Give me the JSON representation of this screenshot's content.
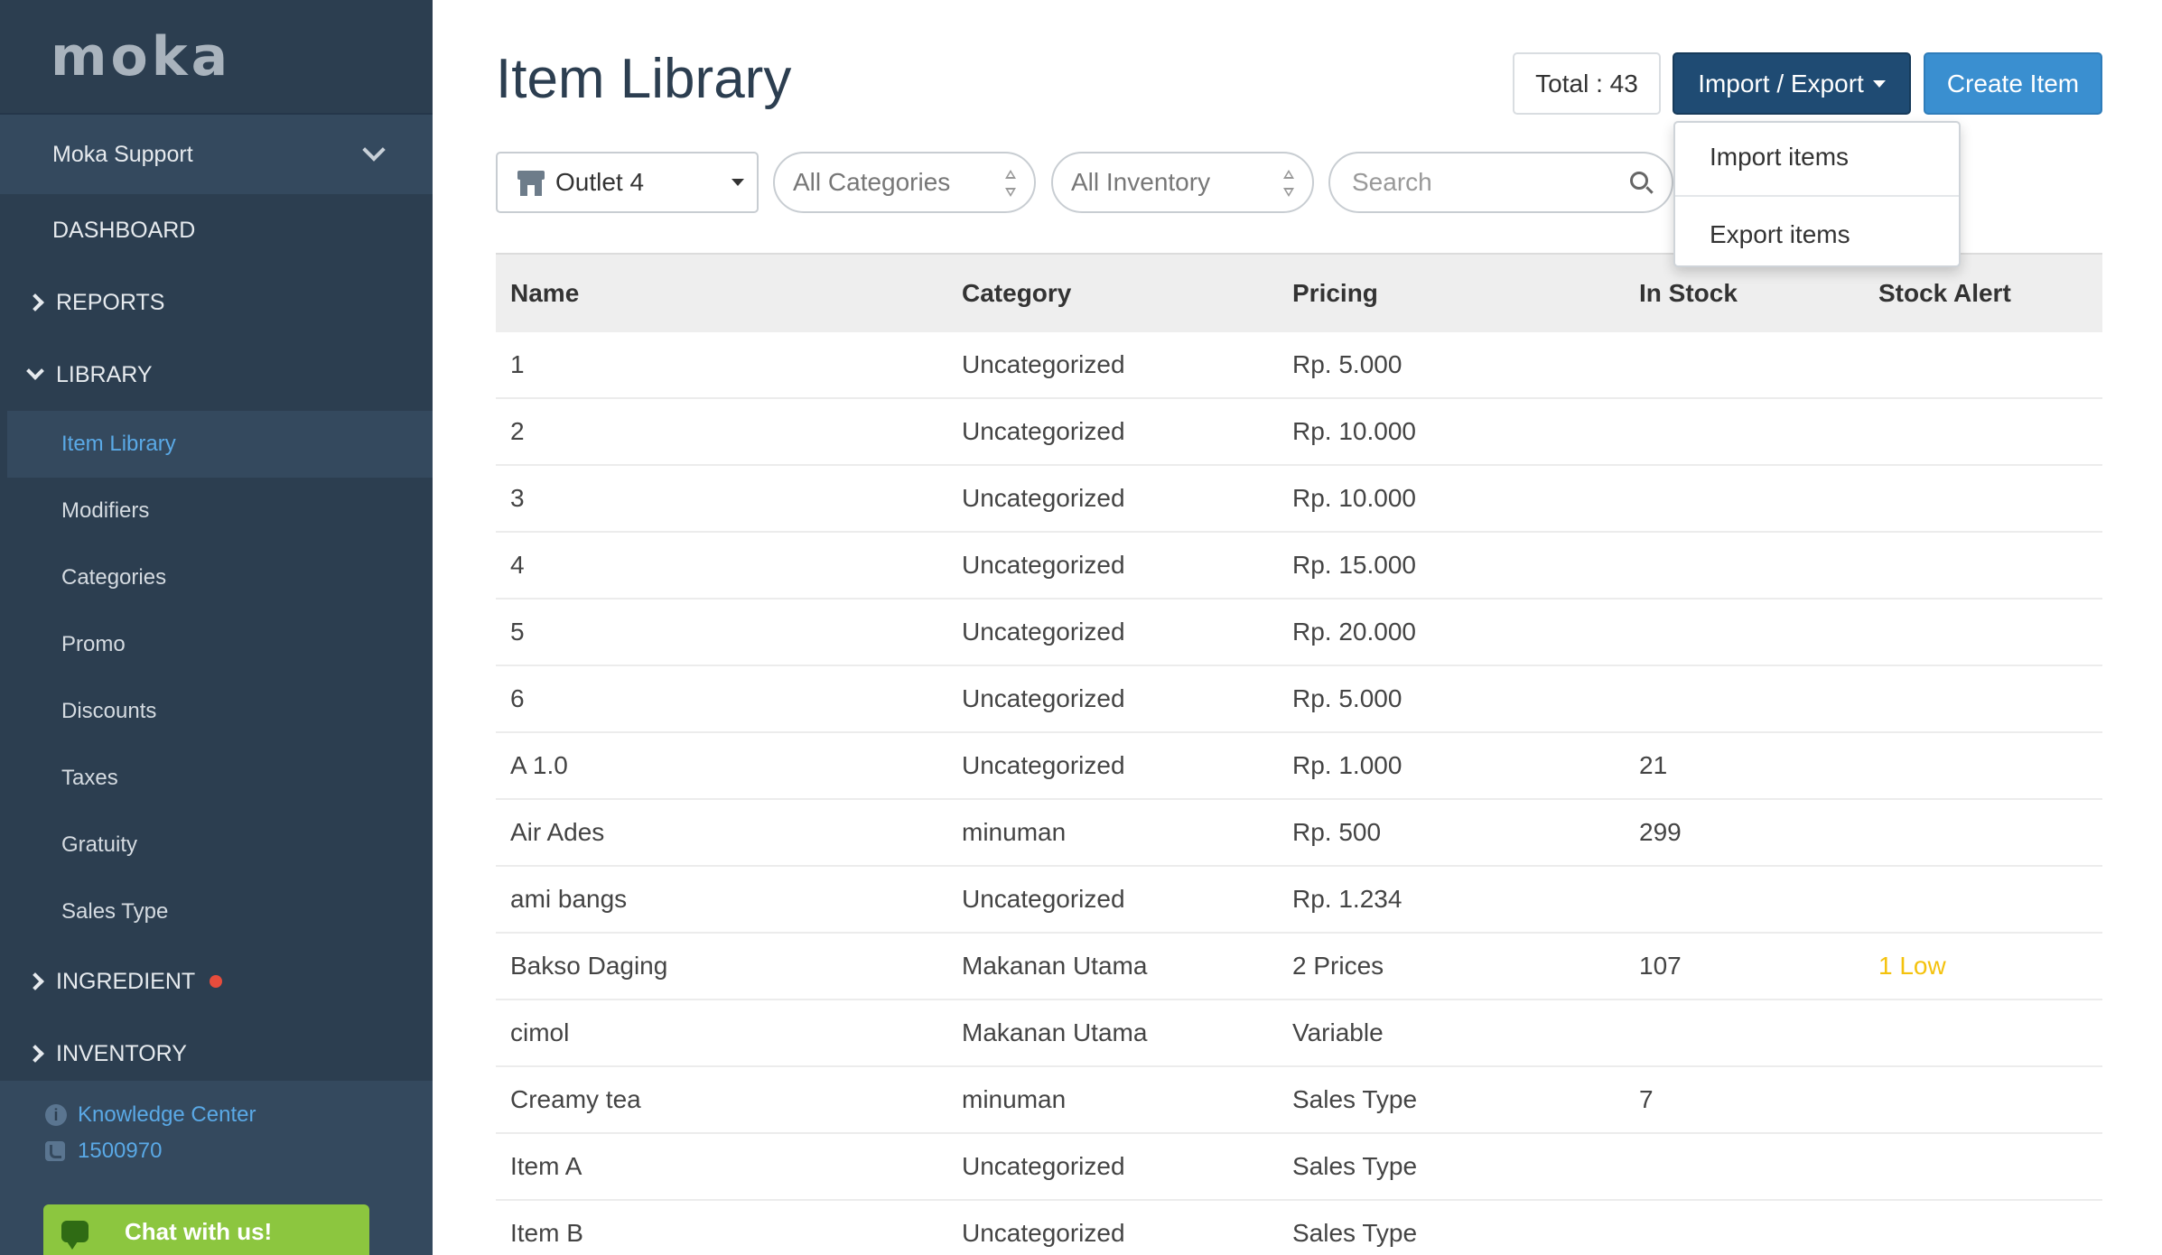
{
  "sidebar": {
    "logo": "moka",
    "account": "Moka Support",
    "dashboard": "DASHBOARD",
    "reports": "REPORTS",
    "library": "LIBRARY",
    "library_items": [
      "Item Library",
      "Modifiers",
      "Categories",
      "Promo",
      "Discounts",
      "Taxes",
      "Gratuity",
      "Sales Type"
    ],
    "ingredient": "INGREDIENT",
    "inventory": "INVENTORY",
    "knowledge_center": "Knowledge Center",
    "phone": "1500970",
    "chat": "Chat with us!",
    "active_color": "#5aa9e6",
    "alert_color": "#e74c3c"
  },
  "header": {
    "title": "Item Library",
    "total": "Total : 43",
    "import_export": "Import / Export",
    "create_item": "Create Item"
  },
  "dropdown": {
    "import": "Import items",
    "export": "Export items"
  },
  "filters": {
    "outlet": "Outlet 4",
    "categories": "All Categories",
    "inventory": "All Inventory",
    "search_placeholder": "Search"
  },
  "table": {
    "headers": [
      "Name",
      "Category",
      "Pricing",
      "In Stock",
      "Stock Alert"
    ],
    "rows": [
      [
        "1",
        "Uncategorized",
        "Rp. 5.000",
        "",
        ""
      ],
      [
        "2",
        "Uncategorized",
        "Rp. 10.000",
        "",
        ""
      ],
      [
        "3",
        "Uncategorized",
        "Rp. 10.000",
        "",
        ""
      ],
      [
        "4",
        "Uncategorized",
        "Rp. 15.000",
        "",
        ""
      ],
      [
        "5",
        "Uncategorized",
        "Rp. 20.000",
        "",
        ""
      ],
      [
        "6",
        "Uncategorized",
        "Rp. 5.000",
        "",
        ""
      ],
      [
        "A 1.0",
        "Uncategorized",
        "Rp. 1.000",
        "21",
        ""
      ],
      [
        "Air Ades",
        "minuman",
        "Rp. 500",
        "299",
        ""
      ],
      [
        "ami bangs",
        "Uncategorized",
        "Rp. 1.234",
        "",
        ""
      ],
      [
        "Bakso Daging",
        "Makanan Utama",
        "2 Prices",
        "107",
        "1 Low"
      ],
      [
        "cimol",
        "Makanan Utama",
        "Variable",
        "",
        ""
      ],
      [
        "Creamy tea",
        "minuman",
        "Sales Type",
        "7",
        ""
      ],
      [
        "Item A",
        "Uncategorized",
        "Sales Type",
        "",
        ""
      ],
      [
        "Item B",
        "Uncategorized",
        "Sales Type",
        "",
        ""
      ]
    ]
  }
}
